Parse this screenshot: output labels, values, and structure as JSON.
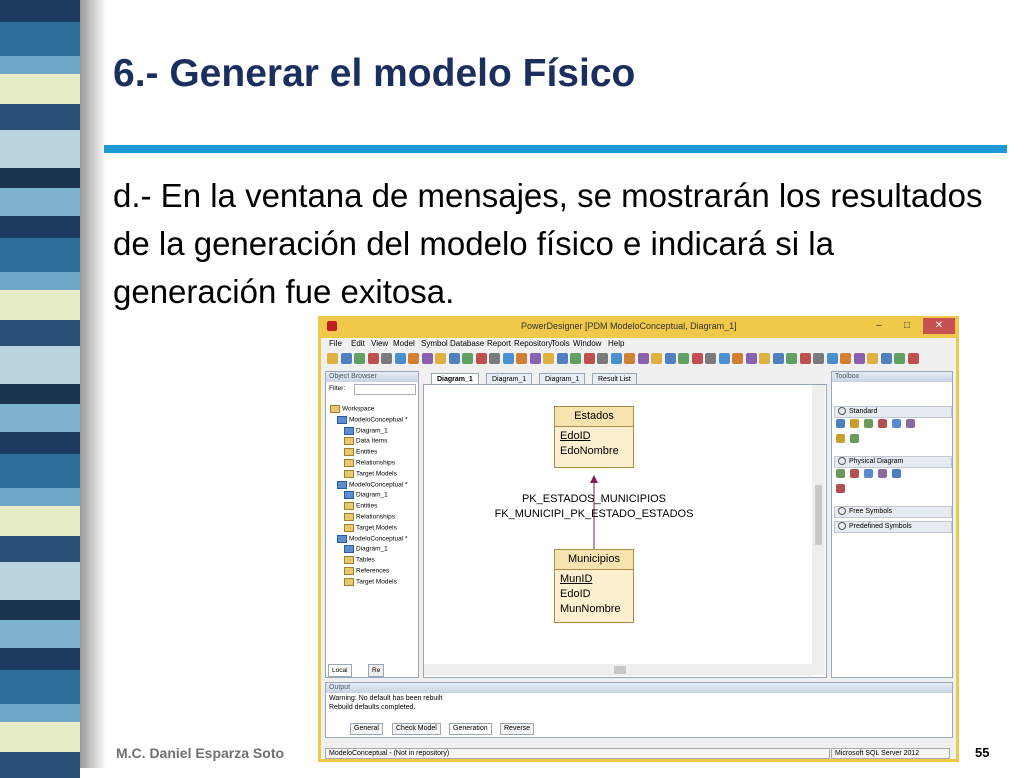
{
  "slide": {
    "title": "6.- Generar el modelo Físico",
    "body": "d.- En la ventana de mensajes, se mostrarán los resultados de la generación del modelo físico e indicará si la generación fue exitosa.",
    "author": "M.C. Daniel Esparza Soto",
    "page_number": "55"
  },
  "colors": {
    "title": "#1b2f5e",
    "rule": "#1d9ad6",
    "window_frame": "#f0c84a"
  },
  "window": {
    "title": "PowerDesigner [PDM ModeloConceptual, Diagram_1]",
    "controls": {
      "minimize": "–",
      "maximize": "□",
      "close": "✕"
    },
    "menu": [
      "File",
      "Edit",
      "View",
      "Model",
      "Symbol",
      "Database",
      "Report",
      "Repository",
      "Tools",
      "Window",
      "Help"
    ],
    "object_browser": {
      "title": "Object Browser",
      "filter_label": "Filter:",
      "tree": [
        {
          "label": "Workspace",
          "indent": 0,
          "icon": "folder"
        },
        {
          "label": "ModeloConceptual *",
          "indent": 1,
          "icon": "diag"
        },
        {
          "label": "Diagram_1",
          "indent": 2,
          "icon": "diag"
        },
        {
          "label": "Data Items",
          "indent": 2,
          "icon": "folder"
        },
        {
          "label": "Entities",
          "indent": 2,
          "icon": "folder"
        },
        {
          "label": "Relationships",
          "indent": 2,
          "icon": "folder"
        },
        {
          "label": "Target Models",
          "indent": 2,
          "icon": "folder"
        },
        {
          "label": "ModeloConceptual *",
          "indent": 1,
          "icon": "diag"
        },
        {
          "label": "Diagram_1",
          "indent": 2,
          "icon": "diag"
        },
        {
          "label": "Entities",
          "indent": 2,
          "icon": "folder"
        },
        {
          "label": "Relationships",
          "indent": 2,
          "icon": "folder"
        },
        {
          "label": "Target Models",
          "indent": 2,
          "icon": "folder"
        },
        {
          "label": "ModeloConceptual *",
          "indent": 1,
          "icon": "diag"
        },
        {
          "label": "Diagram_1",
          "indent": 2,
          "icon": "diag"
        },
        {
          "label": "Tables",
          "indent": 2,
          "icon": "folder"
        },
        {
          "label": "References",
          "indent": 2,
          "icon": "folder"
        },
        {
          "label": "Target Models",
          "indent": 2,
          "icon": "folder"
        }
      ],
      "bottom_tabs": [
        "Local",
        "Re"
      ]
    },
    "tabs": [
      "Diagram_1",
      "Diagram_1",
      "Diagram_1",
      "Result List"
    ],
    "diagram": {
      "entity1": {
        "name": "Estados",
        "attrs": [
          "EdoID",
          "EdoNombre"
        ]
      },
      "entity2": {
        "name": "Municipios",
        "attrs": [
          "MunID",
          "EdoID",
          "MunNombre"
        ]
      },
      "relationship_labels": [
        "PK_ESTADOS_MUNICIPIOS",
        "FK_MUNICIPI_PK_ESTADO_ESTADOS"
      ]
    },
    "toolbox": {
      "title": "Toolbox",
      "sections": [
        "Standard",
        "Physical Diagram",
        "Free Symbols",
        "Predefined Symbols"
      ]
    },
    "output": {
      "title": "Output",
      "lines": [
        "Warning: No default has been rebuilt",
        "Rebuild defaults completed."
      ],
      "tabs": [
        "General",
        "Check Model",
        "Generation",
        "Reverse"
      ]
    },
    "status": {
      "left": "ModeloConceptual - (Not in repository)",
      "right": "Microsoft SQL Server 2012"
    }
  }
}
